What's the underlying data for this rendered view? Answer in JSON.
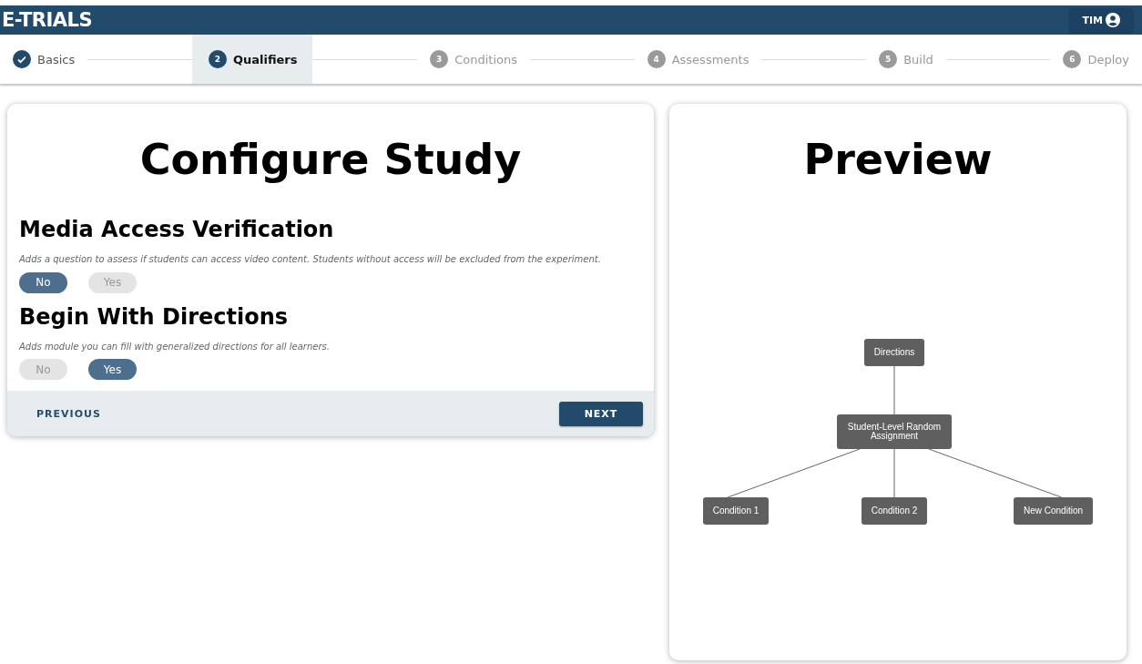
{
  "header": {
    "logo": "E-TRIALS",
    "user": "TIM"
  },
  "steps": [
    {
      "label": "Basics",
      "completed": true,
      "selected": false
    },
    {
      "number": "2",
      "label": "Qualifiers",
      "completed": false,
      "selected": true
    },
    {
      "number": "3",
      "label": "Conditions",
      "completed": false,
      "selected": false
    },
    {
      "number": "4",
      "label": "Assessments",
      "completed": false,
      "selected": false
    },
    {
      "number": "5",
      "label": "Build",
      "completed": false,
      "selected": false
    },
    {
      "number": "6",
      "label": "Deploy",
      "completed": false,
      "selected": false
    }
  ],
  "configure": {
    "title": "Configure Study",
    "sections": [
      {
        "heading": "Media Access Verification",
        "description": "Adds a question to assess if students can access video content. Students without access will be excluded from the experiment.",
        "options": [
          {
            "label": "No",
            "selected": true
          },
          {
            "label": "Yes",
            "selected": false
          }
        ]
      },
      {
        "heading": "Begin With Directions",
        "description": "Adds module you can fill with generalized directions for all learners.",
        "options": [
          {
            "label": "No",
            "selected": false
          },
          {
            "label": "Yes",
            "selected": true
          }
        ]
      }
    ],
    "previous": "PREVIOUS",
    "next": "NEXT"
  },
  "preview": {
    "title": "Preview",
    "diagram": {
      "label": "Directions",
      "children": [
        {
          "label": "Student-Level Random Assignment",
          "children": [
            {
              "label": "Condition 1"
            },
            {
              "label": "Condition 2"
            },
            {
              "label": "New Condition"
            }
          ]
        }
      ]
    }
  }
}
